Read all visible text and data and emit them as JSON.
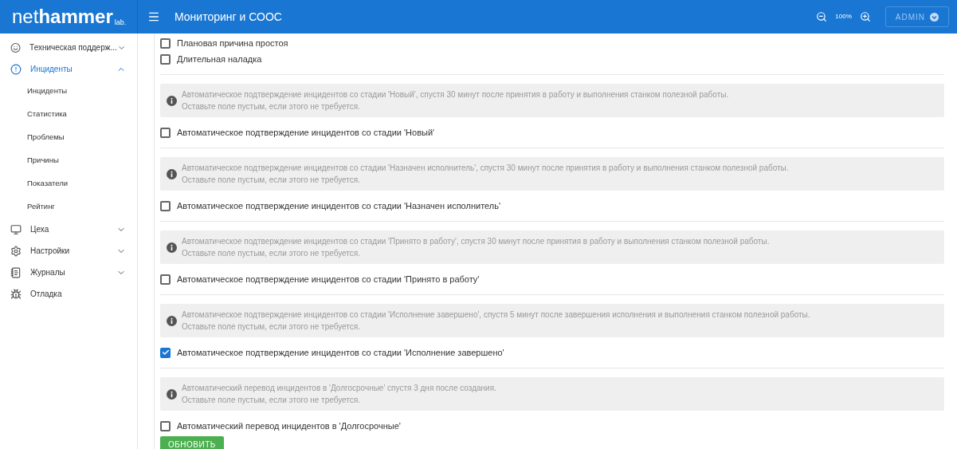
{
  "header": {
    "logo": {
      "light": "net",
      "bold": "hammer",
      "suffix": "lab."
    },
    "title": "Мониторинг и СООС",
    "zoom": "100%",
    "user": "ADMIN"
  },
  "sidebar": {
    "items": [
      {
        "label": "Техническая поддерж...",
        "expanded": false,
        "selected": false
      },
      {
        "label": "Инциденты",
        "expanded": true,
        "selected": true,
        "children": [
          {
            "label": "Инциденты"
          },
          {
            "label": "Статистика"
          },
          {
            "label": "Проблемы"
          },
          {
            "label": "Причины"
          },
          {
            "label": "Показатели"
          },
          {
            "label": "Рейтинг"
          }
        ]
      },
      {
        "label": "Цеха",
        "expanded": false,
        "selected": false
      },
      {
        "label": "Настройки",
        "expanded": false,
        "selected": false
      },
      {
        "label": "Журналы",
        "expanded": false,
        "selected": false
      },
      {
        "label": "Отладка",
        "selected": false
      }
    ]
  },
  "top_checkboxes": [
    {
      "label": "Плановая причина простоя",
      "checked": false
    },
    {
      "label": "Длительная наладка",
      "checked": false
    }
  ],
  "sections": [
    {
      "info": [
        "Автоматическое подтверждение инцидентов со стадии 'Новый', спустя 30 минут после принятия в работу и выполнения станком полезной работы.",
        "Оставьте поле пустым, если этого не требуется."
      ],
      "checkbox": {
        "label": "Автоматическое подтверждение инцидентов со стадии 'Новый'",
        "checked": false
      }
    },
    {
      "info": [
        "Автоматическое подтверждение инцидентов со стадии 'Назначен исполнитель', спустя 30 минут после принятия в работу и выполнения станком полезной работы.",
        "Оставьте поле пустым, если этого не требуется."
      ],
      "checkbox": {
        "label": "Автоматическое подтверждение инцидентов со стадии 'Назначен исполнитель'",
        "checked": false
      }
    },
    {
      "info": [
        "Автоматическое подтверждение инцидентов со стадии 'Принято в работу', спустя 30 минут после принятия в работу и выполнения станком полезной работы.",
        "Оставьте поле пустым, если этого не требуется."
      ],
      "checkbox": {
        "label": "Автоматическое подтверждение инцидентов со стадии 'Принято в работу'",
        "checked": false
      }
    },
    {
      "info": [
        "Автоматическое подтверждение инцидентов со стадии 'Исполнение завершено', спустя 5 минут после завершения исполнения и выполнения станком полезной работы.",
        "Оставьте поле пустым, если этого не требуется."
      ],
      "checkbox": {
        "label": "Автоматическое подтверждение инцидентов со стадии 'Исполнение завершено'",
        "checked": true
      }
    },
    {
      "info": [
        "Автоматический перевод инцидентов в 'Долгосрочные' спустя 3 дня после создания.",
        "Оставьте поле пустым, если этого не требуется."
      ],
      "checkbox": {
        "label": "Автоматический перевод инцидентов в 'Долгосрочные'",
        "checked": false
      }
    }
  ],
  "button": "ОБНОВИТЬ"
}
